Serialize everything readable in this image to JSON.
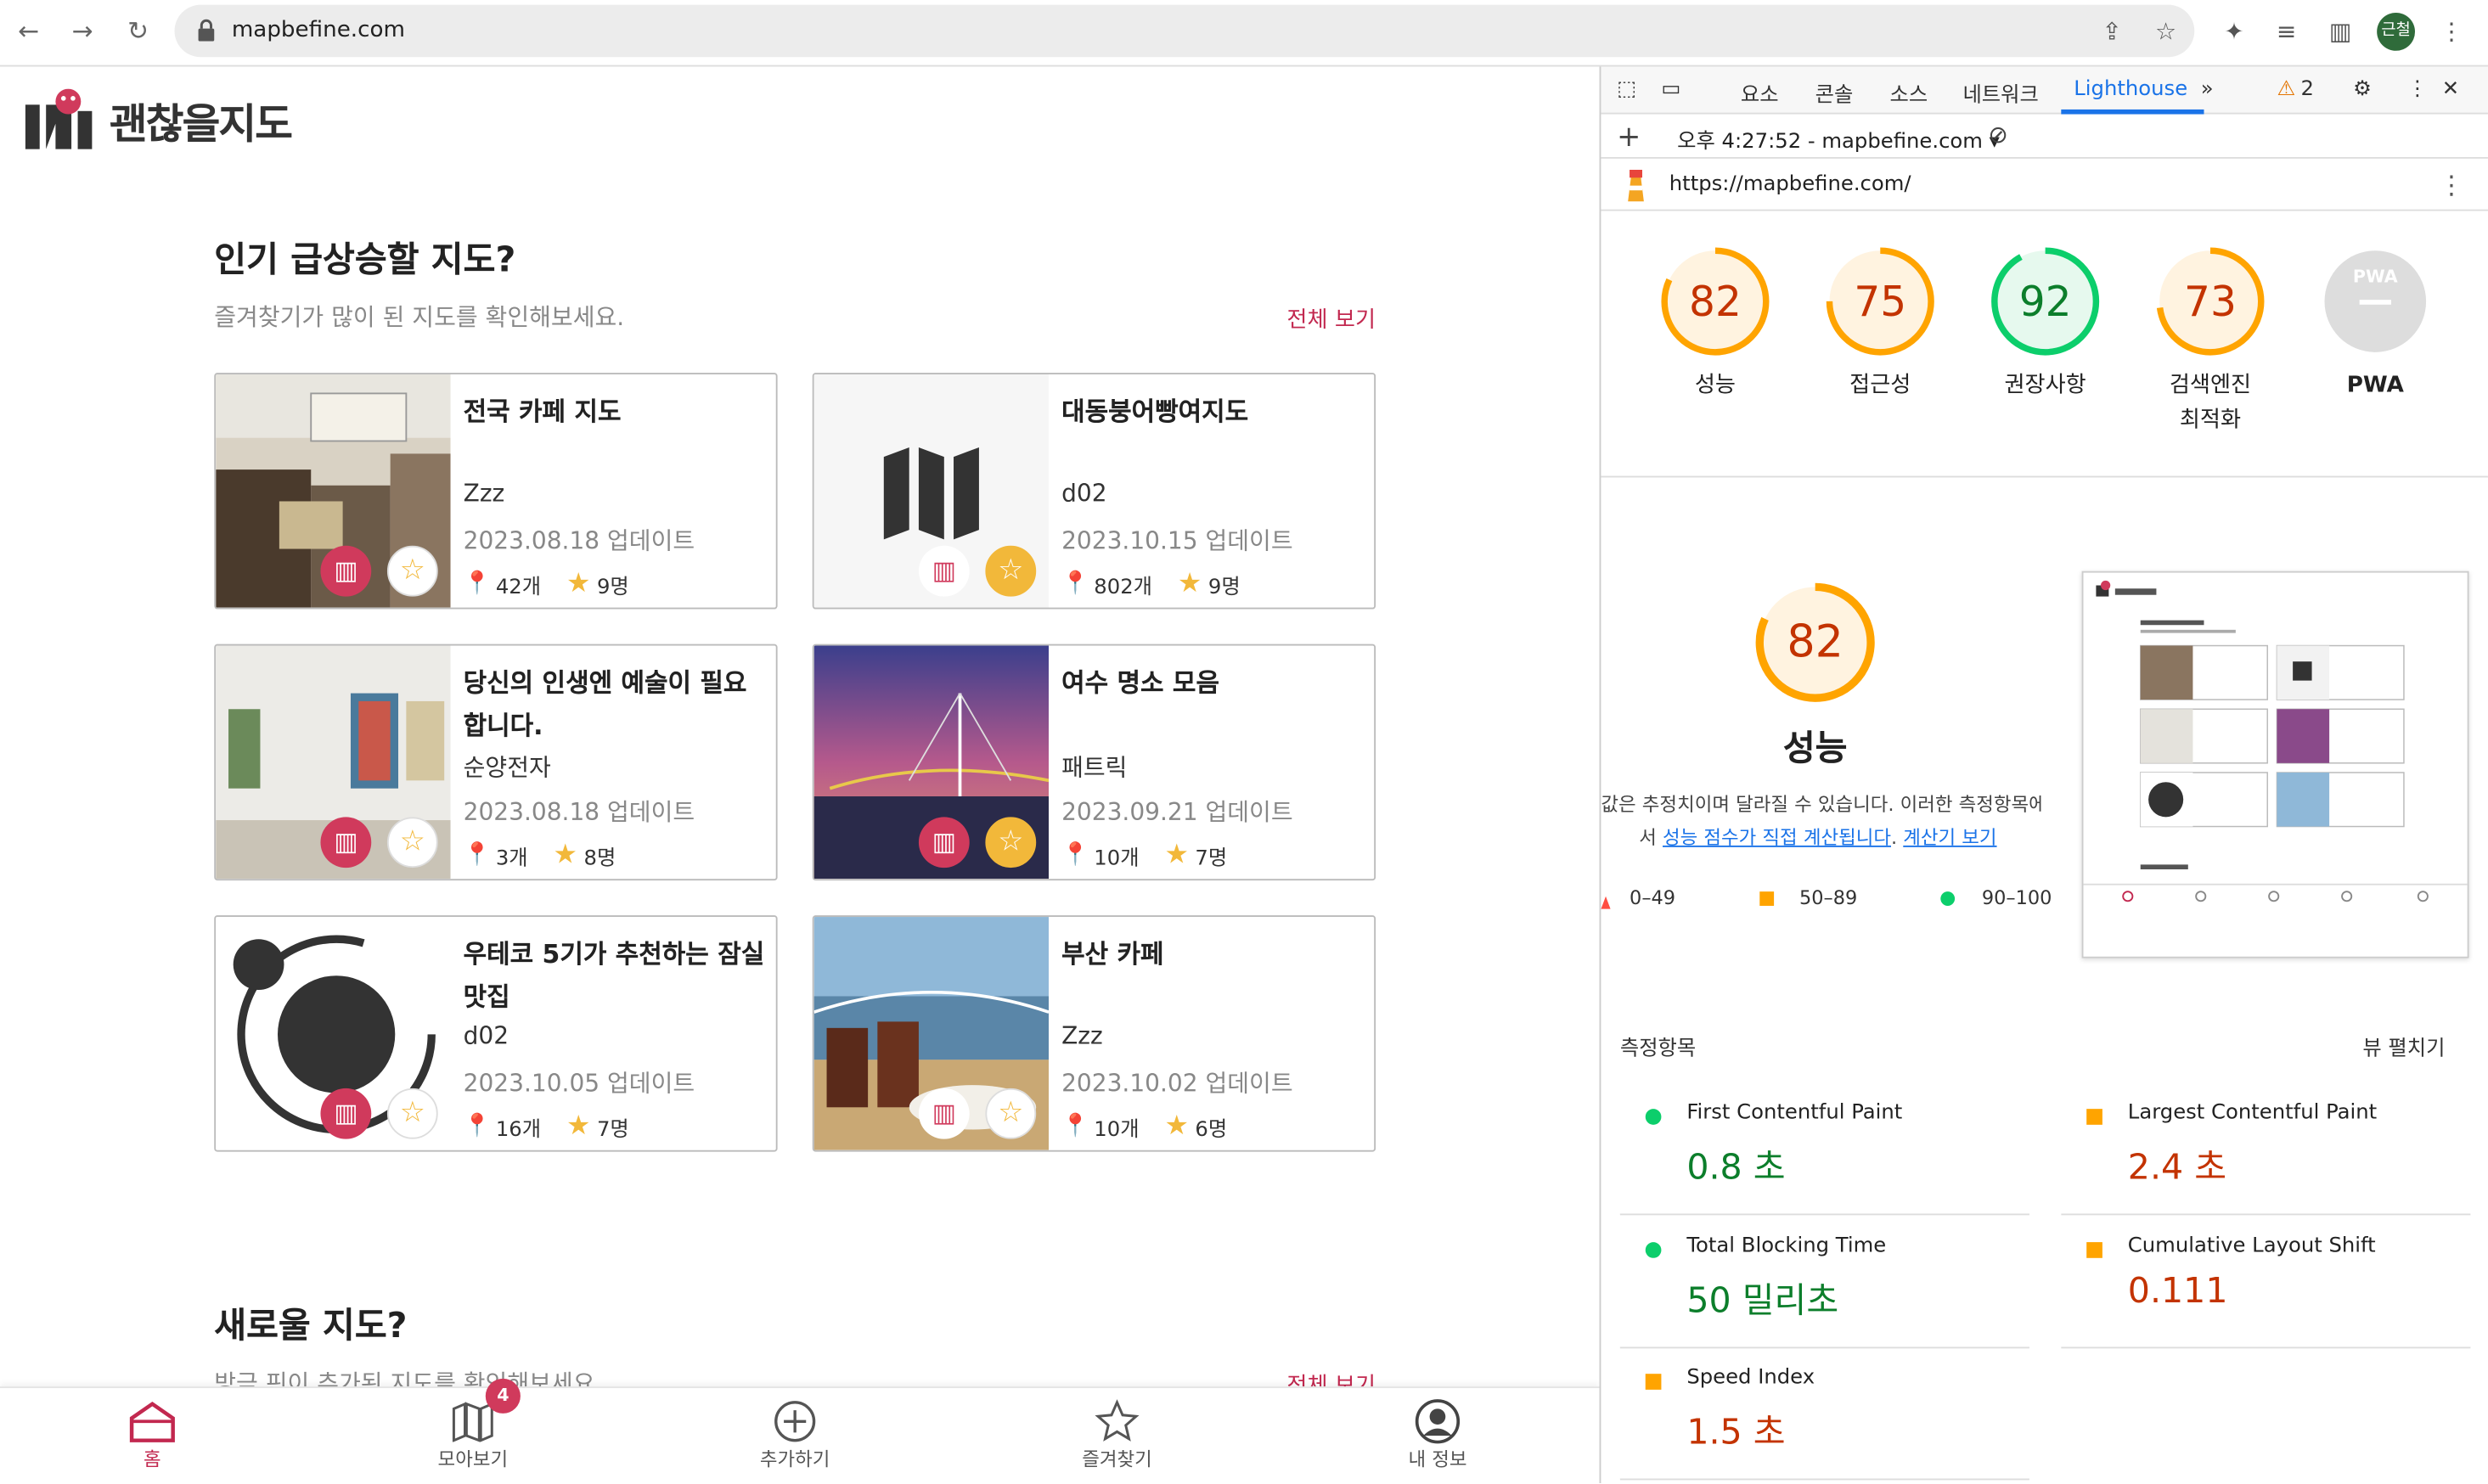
{
  "browser": {
    "url": "mapbefine.com",
    "profile_initials": "근철"
  },
  "page": {
    "logo_text": "괜찮을지도",
    "section1": {
      "title": "인기 급상승할 지도?",
      "subtitle": "즐겨찾기가 많이 된 지도를 확인해보세요.",
      "see_all": "전체 보기"
    },
    "cards": [
      {
        "title": "전국 카페 지도",
        "author": "Zzz",
        "date": "2023.08.18 업데이트",
        "pins": "42개",
        "stars": "9명",
        "starred": false
      },
      {
        "title": "대동붕어빵여지도",
        "author": "d02",
        "date": "2023.10.15 업데이트",
        "pins": "802개",
        "stars": "9명",
        "starred": true
      },
      {
        "title": "당신의 인생엔 예술이 필요합니다.",
        "author": "순양전자",
        "date": "2023.08.18 업데이트",
        "pins": "3개",
        "stars": "8명",
        "starred": false
      },
      {
        "title": "여수 명소 모음",
        "author": "패트릭",
        "date": "2023.09.21 업데이트",
        "pins": "10개",
        "stars": "7명",
        "starred": true
      },
      {
        "title": "우테코 5기가 추천하는 잠실 맛집",
        "author": "d02",
        "date": "2023.10.05 업데이트",
        "pins": "16개",
        "stars": "7명",
        "starred": false
      },
      {
        "title": "부산 카페",
        "author": "Zzz",
        "date": "2023.10.02 업데이트",
        "pins": "10개",
        "stars": "6명",
        "starred": false
      }
    ],
    "section2": {
      "title": "새로울 지도?",
      "subtitle": "방금 핀이 추가된 지도를 확인해보세요.",
      "see_all": "전체 보기"
    }
  },
  "bottom_nav": {
    "items": [
      {
        "label": "홈",
        "icon": "home-icon",
        "active": true
      },
      {
        "label": "모아보기",
        "icon": "map-icon",
        "active": false
      },
      {
        "label": "추가하기",
        "icon": "plus-circle-icon",
        "active": false
      },
      {
        "label": "즐겨찾기",
        "icon": "star-icon",
        "active": false
      },
      {
        "label": "내 정보",
        "icon": "profile-icon",
        "active": false
      }
    ],
    "badge_count": "4"
  },
  "devtools": {
    "tabs": [
      "요소",
      "콘솔",
      "소스",
      "네트워크",
      "Lighthouse"
    ],
    "active_tab": "Lighthouse",
    "warning_count": "2",
    "report_time": "오후 4:27:52 - mapbefine.com",
    "report_url": "https://mapbefine.com/",
    "scores": [
      {
        "label": "성능",
        "value": "82",
        "color": "#ffa400"
      },
      {
        "label": "접근성",
        "value": "75",
        "color": "#ffa400"
      },
      {
        "label": "권장사항",
        "value": "92",
        "color": "#0cce6b"
      },
      {
        "label": "검색엔진\n최적화",
        "value": "73",
        "color": "#ffa400"
      },
      {
        "label": "PWA",
        "value": "PWA",
        "color": "#cccccc"
      }
    ],
    "big_score": {
      "value": "82",
      "label": "성능"
    },
    "note_line1": "값은 추정치이며 달라질 수 있습니다. 이러한 측정항목에",
    "note_line2_prefix": "서 ",
    "note_link1": "성능 점수가 직접 계산됩니다",
    "note_link2": "계산기 보기",
    "legend": [
      {
        "range": "0–49",
        "shape": "triangle",
        "color": "#ff4e42"
      },
      {
        "range": "50–89",
        "shape": "square",
        "color": "#ffa400"
      },
      {
        "range": "90–100",
        "shape": "circle",
        "color": "#0cce6b"
      }
    ],
    "metrics_heading": "측정항목",
    "expand_view": "뷰 펼치기",
    "metrics": [
      {
        "name": "First Contentful Paint",
        "value": "0.8 초",
        "status": "green"
      },
      {
        "name": "Largest Contentful Paint",
        "value": "2.4 초",
        "status": "orange"
      },
      {
        "name": "Total Blocking Time",
        "value": "50 밀리초",
        "status": "green"
      },
      {
        "name": "Cumulative Layout Shift",
        "value": "0.111",
        "status": "orange"
      },
      {
        "name": "Speed Index",
        "value": "1.5 초",
        "status": "orange"
      }
    ]
  }
}
